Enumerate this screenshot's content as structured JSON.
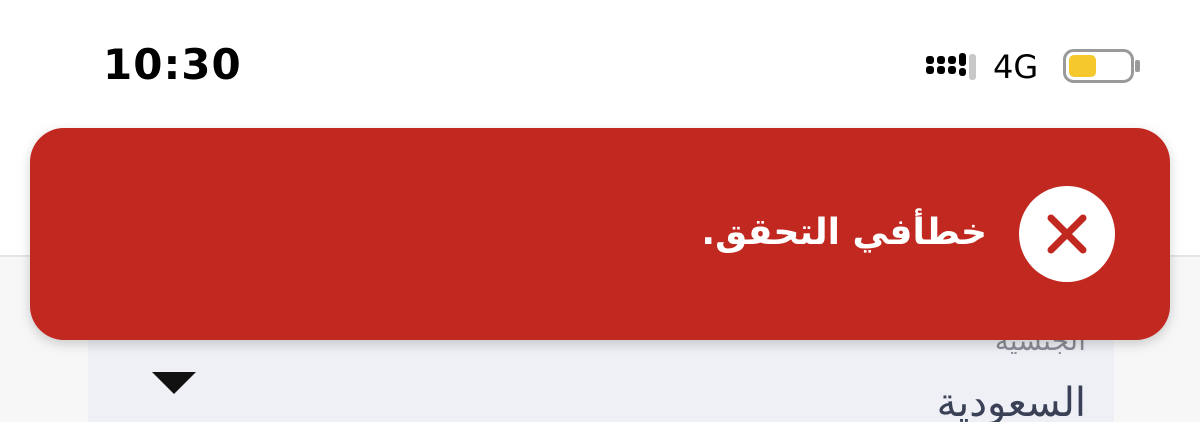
{
  "status_bar": {
    "time": "10:30",
    "network": "4G",
    "signal_icon": "signal-bars-icon",
    "battery_icon": "battery-icon",
    "battery_level": 0.45,
    "battery_color": "#f5c92e"
  },
  "toast": {
    "message": "خطأفي التحقق.",
    "icon": "close-icon",
    "background_color": "#c12920"
  },
  "form": {
    "nationality_field": {
      "label": "الجنسية",
      "value": "السعودية",
      "dropdown_icon": "dropdown-arrow-icon"
    }
  }
}
